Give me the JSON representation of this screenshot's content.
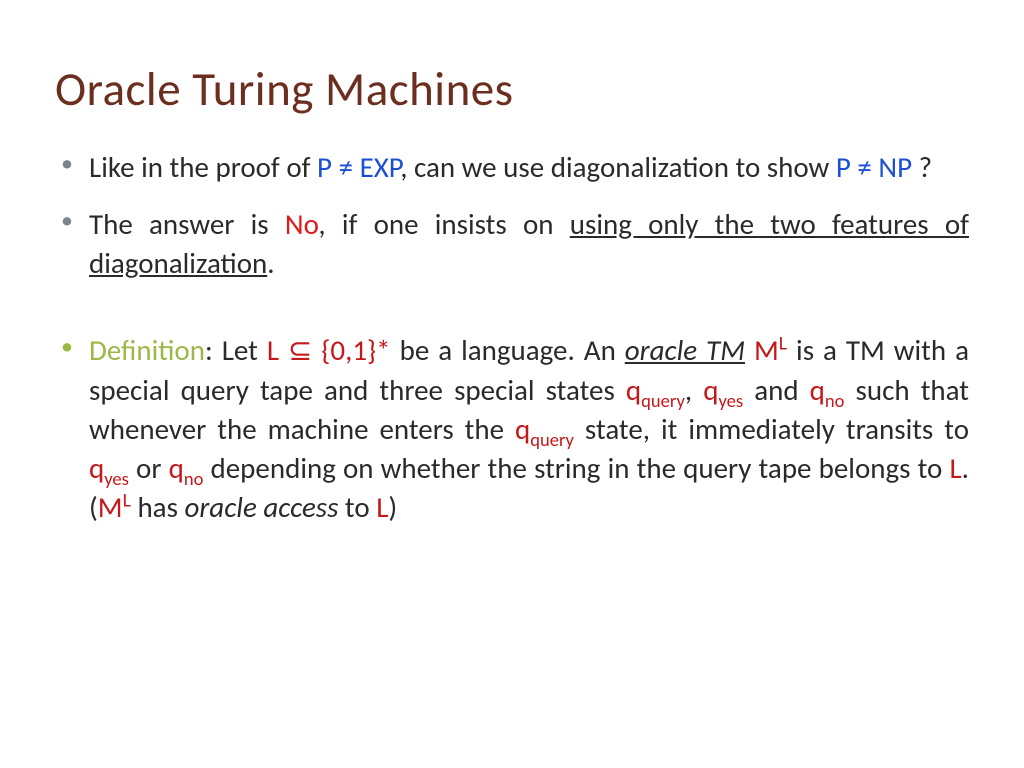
{
  "title": "Oracle Turing Machines",
  "b1": {
    "t1": "Like in the proof of ",
    "pexp": "P ≠ EXP",
    "t2": ", can we use diagonalization to show ",
    "pnp": "P ≠ NP",
    "t3": " ?"
  },
  "b2": {
    "t1": "The answer is ",
    "no": "No",
    "t2": ", if one insists on ",
    "ul": "using only the two features of diagonalization",
    "t3": "."
  },
  "b3": {
    "def": "Definition",
    "t1": ": Let ",
    "lset": "L ⊆ {0,1}*",
    "t2": " be a language. An ",
    "otm": "oracle TM",
    "sp": " ",
    "m": "M",
    "lsup": "L",
    "t3": " is a TM with a special query tape and three special states ",
    "q": "q",
    "query": "query",
    "comma": ", ",
    "yes": "yes",
    "and": " and ",
    "no": "no",
    "t4": " such that whenever the machine enters the ",
    "t5": " state, it immediately transits to ",
    "or": " or ",
    "t6": " depending on whether the string in the query tape belongs to ",
    "l": "L",
    "t7": ".    (",
    "has": " has ",
    "oa": "oracle access",
    "to": " to ",
    "close": ")"
  }
}
